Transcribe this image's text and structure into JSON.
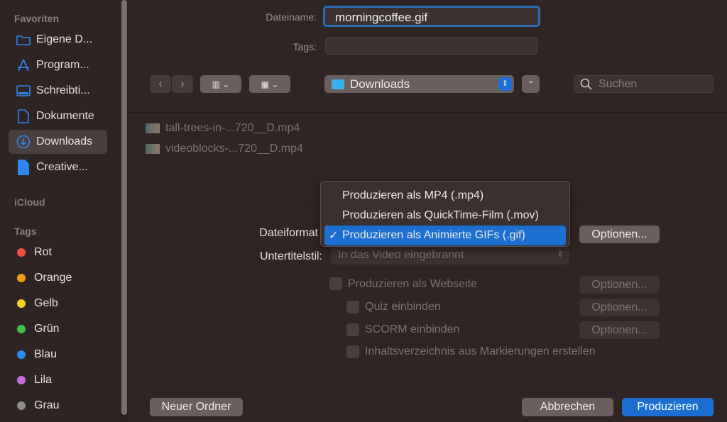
{
  "sidebar": {
    "favorites_header": "Favoriten",
    "favorites": [
      {
        "label": "Eigene D...",
        "icon": "folder-icon"
      },
      {
        "label": "Program...",
        "icon": "applications-icon"
      },
      {
        "label": "Schreibti...",
        "icon": "desktop-icon"
      },
      {
        "label": "Dokumente",
        "icon": "document-icon"
      },
      {
        "label": "Downloads",
        "icon": "download-icon",
        "selected": true
      },
      {
        "label": "Creative...",
        "icon": "file-icon"
      }
    ],
    "icloud_header": "iCloud",
    "tags_header": "Tags",
    "tags": [
      {
        "label": "Rot",
        "color": "#f0504a"
      },
      {
        "label": "Orange",
        "color": "#f59a14"
      },
      {
        "label": "Gelb",
        "color": "#f7d21e"
      },
      {
        "label": "Grün",
        "color": "#3cc24a"
      },
      {
        "label": "Blau",
        "color": "#2a8bf2"
      },
      {
        "label": "Lila",
        "color": "#c76be0"
      },
      {
        "label": "Grau",
        "color": "#8e8e8e"
      }
    ]
  },
  "form": {
    "filename_label": "Dateiname:",
    "filename_value": "morningcoffee.gif",
    "tags_label": "Tags:",
    "tags_value": "",
    "location": "Downloads",
    "search_placeholder": "Suchen"
  },
  "files": [
    "tall-trees-in-...720__D.mp4",
    "videoblocks-...720__D.mp4"
  ],
  "options": {
    "format_label": "Dateiformat",
    "format_menu": [
      {
        "label": "Produzieren als MP4 (.mp4)",
        "selected": false
      },
      {
        "label": "Produzieren als QuickTime-Film (.mov)",
        "selected": false
      },
      {
        "label": "Produzieren als Animierte GIFs (.gif)",
        "selected": true
      }
    ],
    "check_mark": "✓",
    "options_button": "Optionen...",
    "subtitle_label": "Untertitelstil:",
    "subtitle_value": "In das Video eingebrannt",
    "webpage": "Produzieren als Webseite",
    "quiz": "Quiz einbinden",
    "scorm": "SCORM einbinden",
    "toc": "Inhaltsverzeichnis aus Markierungen erstellen"
  },
  "footer": {
    "new_folder": "Neuer Ordner",
    "cancel": "Abbrechen",
    "produce": "Produzieren"
  },
  "colors": {
    "accent": "#1c6fd1"
  }
}
